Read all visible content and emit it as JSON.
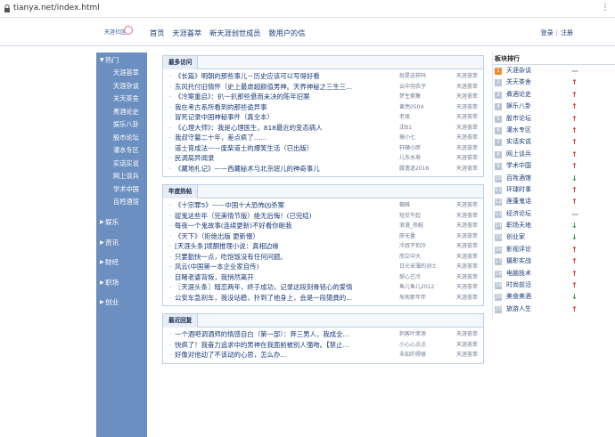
{
  "browser": {
    "url": "tianya.net/index.html"
  },
  "header": {
    "logo_text": "天涯社区",
    "nav": [
      "首页",
      "天涯荟萃",
      "新天涯创世成员",
      "致用户的信"
    ],
    "login": "登录",
    "separator": "|",
    "register": "注册"
  },
  "sidebar": {
    "hot_label": "热门",
    "hot_items": [
      "天涯荟萃",
      "天涯杂谈",
      "关天茶舍",
      "煮酒论史",
      "娱乐八卦",
      "股市论坛",
      "灌水专区",
      "实话实说",
      "网上谈兵",
      "学术中国",
      "百姓酒馆"
    ],
    "sections": [
      "娱乐",
      "资讯",
      "财经",
      "职场",
      "创业"
    ]
  },
  "panels": [
    {
      "title": "最多访问",
      "rows": [
        {
          "title": "《长篇》明朝的那些事儿－历史应该可以写得好看",
          "author": "就是这样吗",
          "board": "天涯荟萃"
        },
        {
          "title": "东风托付旧情怀（史上最虐超颜值男神。天界神秘之三生三...",
          "author": "云中羽衣子",
          "board": "天涯荟萃"
        },
        {
          "title": "《冷案重启》：扒一扒那些悬而未决的陈年旧案",
          "author": "梦生樊篱",
          "board": "天涯荟萃"
        },
        {
          "title": "我在考古系所看到的那些诡异事",
          "author": "黄亮0504",
          "board": "天涯荟萃"
        },
        {
          "title": "冒死记录中国神秘事件（真全本）",
          "author": "老夜",
          "board": "天涯荟萃"
        },
        {
          "title": "《心理大师》：我是心理医生，818最近的变态病人",
          "author": "沈B1",
          "board": "天涯荟萃"
        },
        {
          "title": "我叔守墓二十年，差点疯了……",
          "author": "搞小七",
          "board": "天涯荟萃"
        },
        {
          "title": "道士育成法——废柴道士的爆笑生活（已出版）",
          "author": "轩辕小胖",
          "board": "天涯荟萃"
        },
        {
          "title": "民调局异闻录",
          "author": "儿东水寿",
          "board": "天涯荟萃"
        },
        {
          "title": "《藏地札记》——西藏秘术与北京妞儿的神奇事儿",
          "author": "滕遗迷2016",
          "board": "天涯荟萃"
        }
      ]
    },
    {
      "title": "年度热帖",
      "rows": [
        {
          "title": "《十宗罪5》——中国十大恐怖凶杀案",
          "author": "蜘蛛",
          "board": "天涯荟萃"
        },
        {
          "title": "捉鬼这些年（完美情节版）绝无后悔！(已完结)",
          "author": "短见午起",
          "board": "天涯荟萃"
        },
        {
          "title": "每夜一个鬼故事(连续更新)不好看你砸我",
          "author": "浪漫_热鲑",
          "board": "天涯荟萃"
        },
        {
          "title": "《天下》（拒绝出版 更新慢）",
          "author": "廖无量",
          "board": "天涯荟萃"
        },
        {
          "title": "[天涯头条]境酮推理小说：真相边缘",
          "author": "冷叔不怕冷",
          "board": "天涯荟萃"
        },
        {
          "title": "只要勤快一点，吃饱饭没有任何问题。",
          "author": "而立中大",
          "board": "天涯荟萃"
        },
        {
          "title": "风云(中国第一本企业家自传)",
          "author": "日光采薄的词士",
          "board": "天涯荟萃"
        },
        {
          "title": "目睹老婆背叛，我悄然离开",
          "author": "郝心已冷",
          "board": "天涯荟萃"
        },
        {
          "title": "〖天涯头条〗暗恋两年，终于成功，记录这段刻骨铭心的爱情",
          "author": "鱼儿鱼儿2012",
          "board": "天涯荟萃"
        },
        {
          "title": "公安车急刹车，我没站稳，扑到了他身上，会是一段猿粪的...",
          "author": "匆匆那年伴",
          "board": "天涯荟萃"
        }
      ]
    },
    {
      "title": "最近回复",
      "rows": [
        {
          "title": "一个酒吧调酒师的情感自白（第一部）：奔三男人，我成全...",
          "author": "刺客叶荣添",
          "board": "天涯荟萃"
        },
        {
          "title": "快疯了！我奋力追求中的男神在我面前被别人强吻。【禁止...",
          "author": "小心心点点",
          "board": "天涯荟萃"
        },
        {
          "title": "好像对他动了不该动的心思，怎么办...",
          "author": "未知的得很",
          "board": "天涯荟萃"
        }
      ]
    }
  ],
  "rank": {
    "title": "板块排行",
    "items": [
      {
        "name": "天涯杂谈",
        "trend": "flat"
      },
      {
        "name": "关天茶舍",
        "trend": "up"
      },
      {
        "name": "煮酒论史",
        "trend": "up"
      },
      {
        "name": "娱乐八卦",
        "trend": "up"
      },
      {
        "name": "股市论坛",
        "trend": "up"
      },
      {
        "name": "灌水专区",
        "trend": "up"
      },
      {
        "name": "实话实说",
        "trend": "up"
      },
      {
        "name": "网上谈兵",
        "trend": "up"
      },
      {
        "name": "学术中国",
        "trend": "up"
      },
      {
        "name": "百姓酒馆",
        "trend": "down"
      },
      {
        "name": "环球时事",
        "trend": "up"
      },
      {
        "name": "莲蓬鬼话",
        "trend": "up"
      },
      {
        "name": "经济论坛",
        "trend": "flat"
      },
      {
        "name": "职场天地",
        "trend": "down"
      },
      {
        "name": "创业家",
        "trend": "down"
      },
      {
        "name": "影视评论",
        "trend": "up"
      },
      {
        "name": "摄影实战",
        "trend": "up"
      },
      {
        "name": "电脑技术",
        "trend": "up"
      },
      {
        "name": "时尚前沿",
        "trend": "up"
      },
      {
        "name": "美食美酒",
        "trend": "down"
      },
      {
        "name": "旅游人生",
        "trend": "up"
      }
    ]
  },
  "colors": {
    "sidebar": "#6c8fc1",
    "link": "#1a3b7a",
    "rank_top": "#f28a2e"
  }
}
